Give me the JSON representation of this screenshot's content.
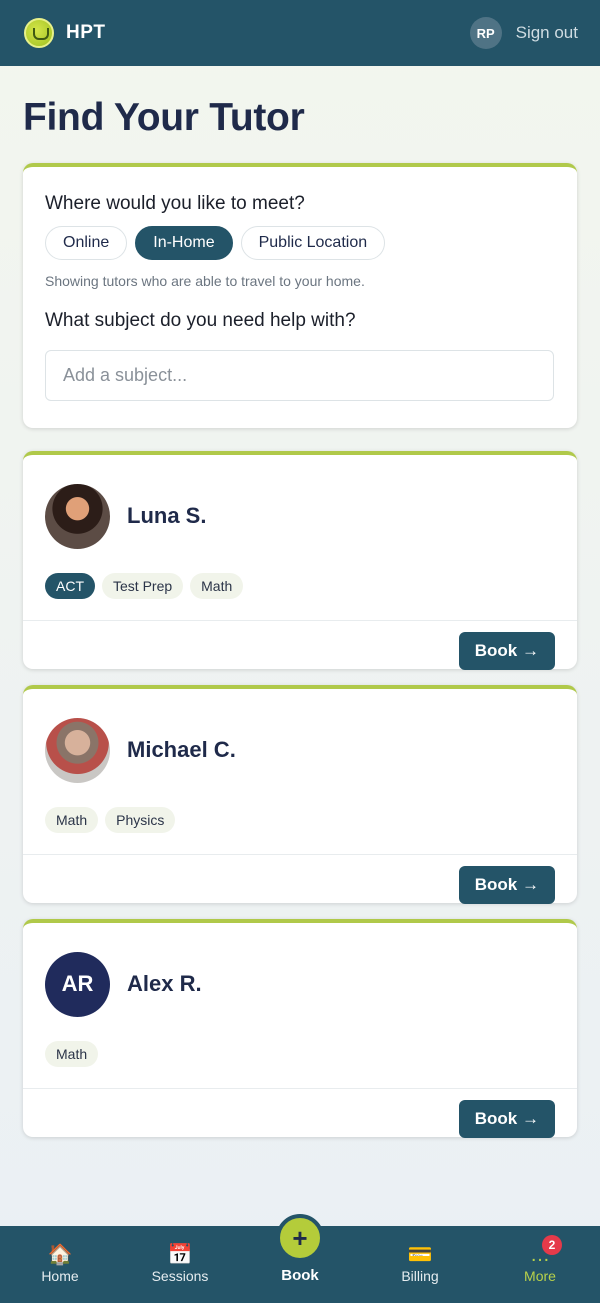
{
  "header": {
    "brand": "HPT",
    "user_initials": "RP",
    "signout_label": "Sign out"
  },
  "page": {
    "title": "Find Your Tutor"
  },
  "search": {
    "meet_question": "Where would you like to meet?",
    "meet_options": [
      "Online",
      "In-Home",
      "Public Location"
    ],
    "selected_meet": "In-Home",
    "hint": "Showing tutors who are able to travel to your home.",
    "subject_question": "What subject do you need help with?",
    "subject_placeholder": "Add a subject..."
  },
  "tutors": [
    {
      "name": "Luna S.",
      "tags": [
        "ACT",
        "Test Prep",
        "Math"
      ],
      "highlight_tag": "ACT",
      "book_label": "Book →"
    },
    {
      "name": "Michael C.",
      "tags": [
        "Math",
        "Physics"
      ],
      "book_label": "Book →"
    },
    {
      "name": "Alex R.",
      "initials": "AR",
      "tags": [
        "Math"
      ],
      "book_label": "Book →"
    }
  ],
  "nav": {
    "items": [
      {
        "label": "Home",
        "icon": "house-icon",
        "glyph": "🏠"
      },
      {
        "label": "Sessions",
        "icon": "calendar-icon",
        "glyph": "📅"
      },
      {
        "label": "Book",
        "icon": "plus-icon",
        "glyph": "+"
      },
      {
        "label": "Billing",
        "icon": "credit-card-icon",
        "glyph": "💳"
      },
      {
        "label": "More",
        "icon": "more-dots-icon",
        "glyph": "…"
      }
    ],
    "more_badge": "2"
  },
  "colors": {
    "primary": "#245468",
    "accent": "#b0c94a",
    "badge": "#e53a4a"
  }
}
